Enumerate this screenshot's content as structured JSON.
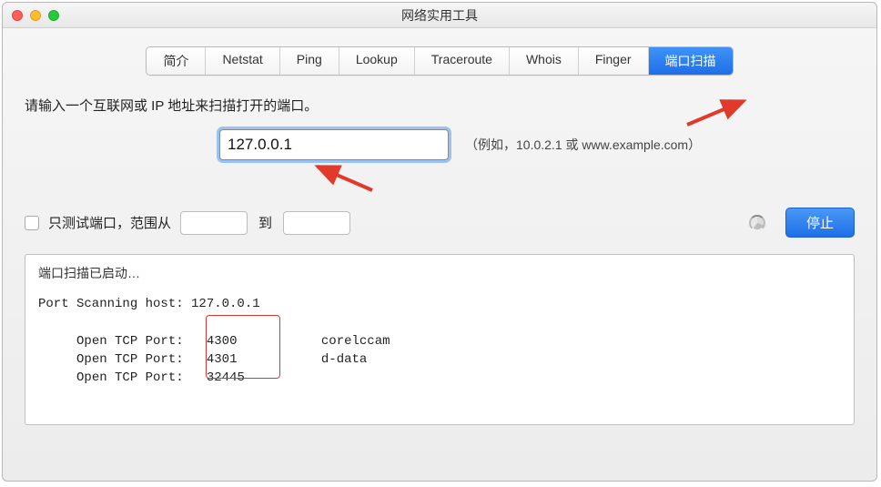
{
  "window": {
    "title": "网络实用工具"
  },
  "tabs": [
    {
      "id": "intro",
      "label": "简介"
    },
    {
      "id": "netstat",
      "label": "Netstat"
    },
    {
      "id": "ping",
      "label": "Ping"
    },
    {
      "id": "lookup",
      "label": "Lookup"
    },
    {
      "id": "traceroute",
      "label": "Traceroute"
    },
    {
      "id": "whois",
      "label": "Whois"
    },
    {
      "id": "finger",
      "label": "Finger"
    },
    {
      "id": "portscan",
      "label": "端口扫描",
      "active": true
    }
  ],
  "prompt": "请输入一个互联网或 IP 地址来扫描打开的端口。",
  "address": {
    "value": "127.0.0.1",
    "example": "（例如，10.0.2.1 或 www.example.com）"
  },
  "options": {
    "test_ports_only_label": "只测试端口，范围从",
    "test_ports_only_checked": false,
    "range_from": "",
    "to_label": "到",
    "range_to": ""
  },
  "action": {
    "stop_label": "停止"
  },
  "output": {
    "status": "端口扫描已启动…",
    "scanning_line": "Port Scanning host: 127.0.0.1",
    "ports": [
      {
        "label": "Open TCP Port:",
        "port": "4300",
        "service": "corelccam"
      },
      {
        "label": "Open TCP Port:",
        "port": "4301",
        "service": "d-data"
      },
      {
        "label": "Open TCP Port:",
        "port": "32445",
        "service": ""
      }
    ]
  },
  "annotation": {
    "arrow_color": "#e23a2a"
  }
}
